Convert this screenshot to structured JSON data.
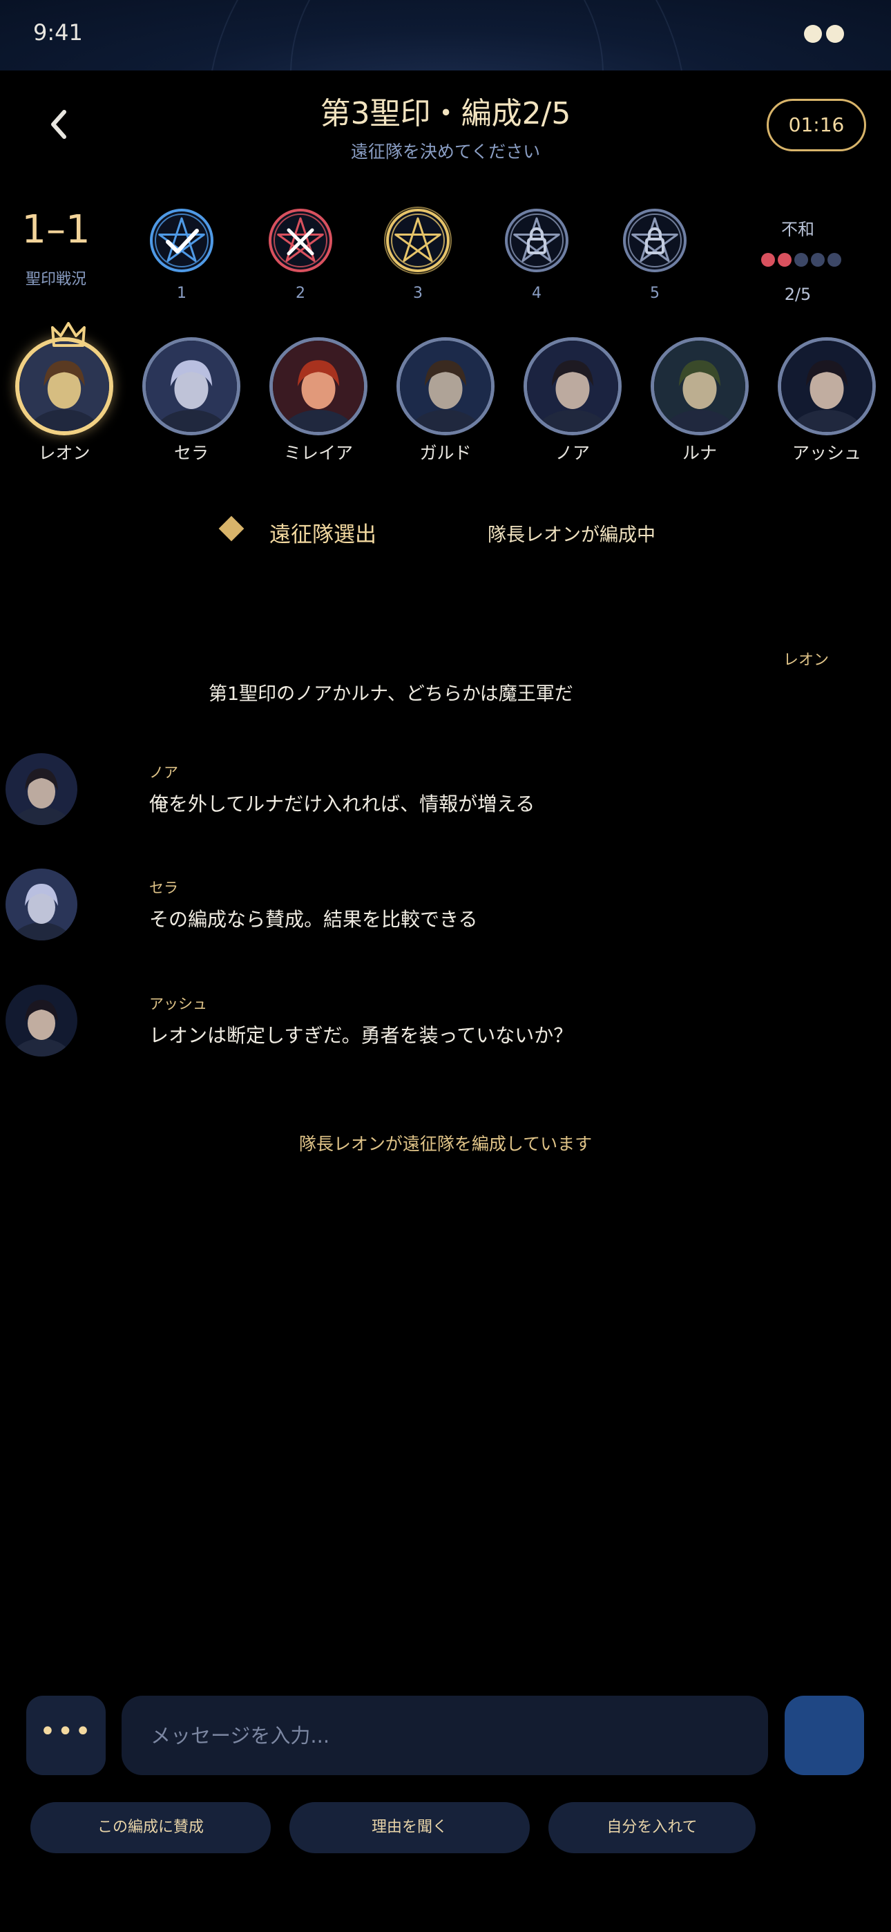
{
  "status": {
    "time": "9:41"
  },
  "header": {
    "title": "第3聖印・編成2/5",
    "subtitle": "遠征隊を決めてください",
    "timer": "01:16",
    "back_icon": "chevron-left-icon"
  },
  "score": {
    "value": "1–1",
    "label": "聖印戦況"
  },
  "seals": [
    {
      "number": "1",
      "state": "success",
      "color": "#4f9ae6",
      "icon": "check-icon"
    },
    {
      "number": "2",
      "state": "failed",
      "color": "#d9515e",
      "icon": "cross-icon"
    },
    {
      "number": "3",
      "state": "current",
      "color": "#e6c46a",
      "icon": "star-icon"
    },
    {
      "number": "4",
      "state": "locked",
      "color": "#6f7fa3",
      "icon": "lock-icon"
    },
    {
      "number": "5",
      "state": "locked",
      "color": "#6f7fa3",
      "icon": "lock-icon"
    }
  ],
  "discord": {
    "label": "不和",
    "count": "2/5",
    "filled": 2,
    "total": 5,
    "filled_color": "#d9515e",
    "empty_color": "#3c4766"
  },
  "members": [
    {
      "name": "レオン",
      "leader": true
    },
    {
      "name": "セラ",
      "leader": false
    },
    {
      "name": "ミレイア",
      "leader": false
    },
    {
      "name": "ガルド",
      "leader": false
    },
    {
      "name": "ノア",
      "leader": false
    },
    {
      "name": "ルナ",
      "leader": false
    },
    {
      "name": "アッシュ",
      "leader": false
    }
  ],
  "phase": {
    "label": "遠征隊選出",
    "status": "隊長レオンが編成中"
  },
  "leader_message": {
    "sender": "レオン",
    "text": "第1聖印のノアかルナ、どちらかは魔王軍だ"
  },
  "chat": [
    {
      "sender": "ノア",
      "text": "俺を外してルナだけ入れれば、情報が増える"
    },
    {
      "sender": "セラ",
      "text": "その編成なら賛成。結果を比較できる"
    },
    {
      "sender": "アッシュ",
      "text": "レオンは断定しすぎだ。勇者を装っていないか？"
    }
  ],
  "system_message": "隊長レオンが遠征隊を編成しています",
  "composer": {
    "more_label": "•••",
    "placeholder": "メッセージを入力..."
  },
  "quick_replies": [
    "この編成に賛成",
    "理由を聞く",
    "自分を入れて"
  ],
  "colors": {
    "accent_gold": "#d8b46a",
    "background": "#000000",
    "panel": "#17223a",
    "send": "#1f4784"
  }
}
